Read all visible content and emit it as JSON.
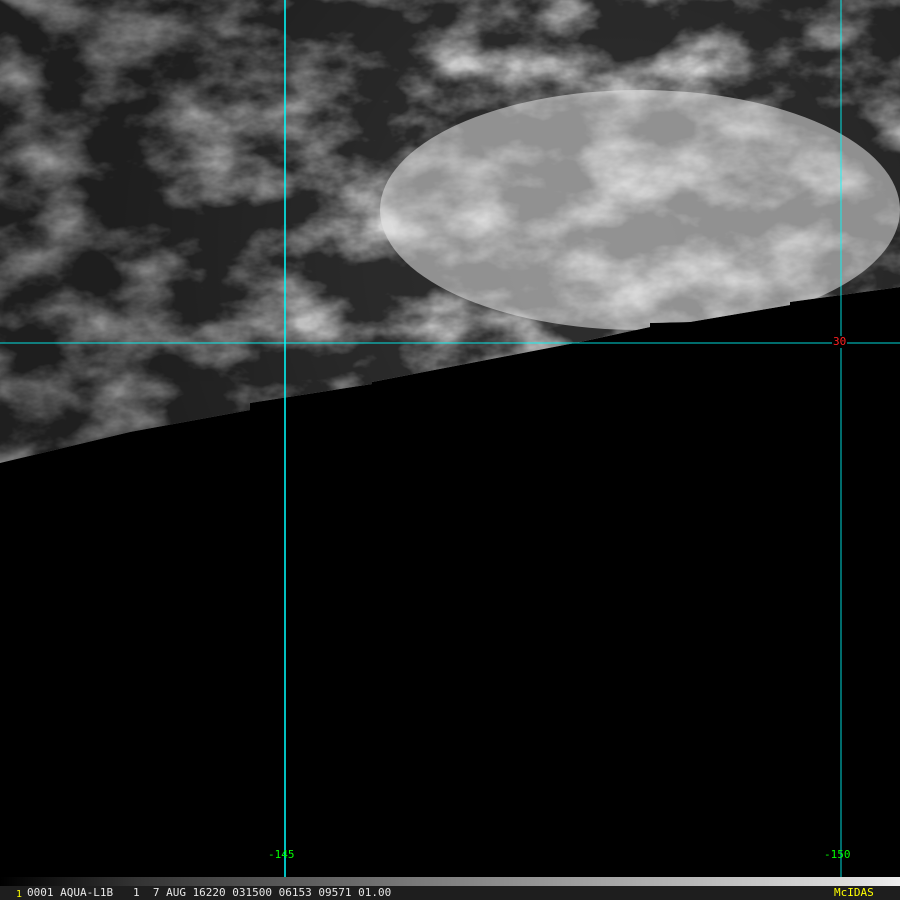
{
  "image": {
    "satellite": "AQUA-L1B",
    "grid_color": "#00ffff",
    "lon_label_color": "#00ff00",
    "lat_label_color": "#ff2020"
  },
  "grid_labels": {
    "longitudes": [
      "-145",
      "-150"
    ],
    "latitudes": [
      "30"
    ]
  },
  "info_bar": {
    "frame_number": "1",
    "text": "0001 AQUA-L1B   1  7 AUG 16220 031500 06153 09571 01.00",
    "brand": "McIDAS"
  }
}
